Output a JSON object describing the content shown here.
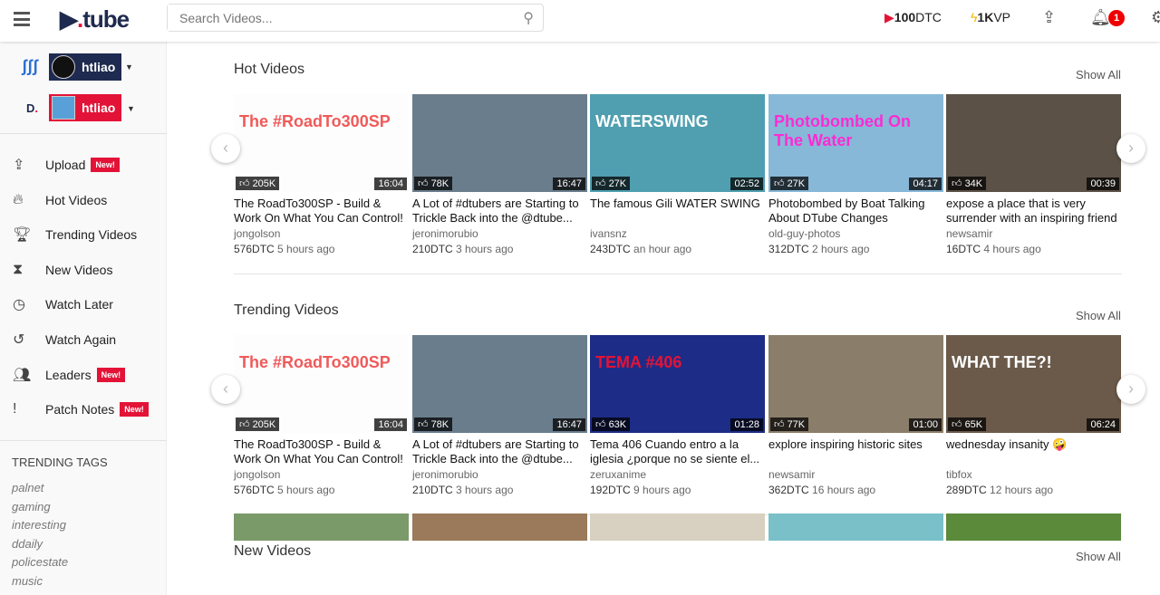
{
  "header": {
    "logo": "D.tube",
    "search_placeholder": "Search Videos...",
    "dtc": "100",
    "dtc_unit": "DTC",
    "vp": "1K",
    "vp_unit": "VP",
    "notif_count": "1"
  },
  "sidebar": {
    "accounts": [
      {
        "network": "steem",
        "name": "htliao"
      },
      {
        "network": "dtube",
        "name": "htliao"
      }
    ],
    "items": [
      {
        "label": "Upload",
        "icon": "upload-icon",
        "new": "New!"
      },
      {
        "label": "Hot Videos",
        "icon": "fire-icon"
      },
      {
        "label": "Trending Videos",
        "icon": "trophy-icon"
      },
      {
        "label": "New Videos",
        "icon": "hourglass-icon"
      },
      {
        "label": "Watch Later",
        "icon": "clock-icon"
      },
      {
        "label": "Watch Again",
        "icon": "history-icon"
      },
      {
        "label": "Leaders",
        "icon": "users-icon",
        "new": "New!"
      },
      {
        "label": "Patch Notes",
        "icon": "exclamation-icon",
        "new": "New!"
      }
    ],
    "trending_title": "TRENDING TAGS",
    "tags": [
      "palnet",
      "gaming",
      "interesting",
      "ddaily",
      "policestate",
      "music"
    ]
  },
  "sections": [
    {
      "title": "Hot Videos",
      "show_all": "Show All",
      "videos": [
        {
          "title": "The RoadTo300SP - Build & Work On What You Can Control!",
          "author": "jongolson",
          "value": "576DTC",
          "time": "5 hours ago",
          "views": "205K",
          "duration": "16:04",
          "thumb_text": "The #RoadTo300SP",
          "color": "#fdfdfd",
          "tcolor": "#f05a5a"
        },
        {
          "title": "A Lot of #dtubers are Starting to Trickle Back into the @dtube...",
          "author": "jeronimorubio",
          "value": "210DTC",
          "time": "3 hours ago",
          "views": "78K",
          "duration": "16:47",
          "thumb_text": "",
          "color": "#6a7d8c"
        },
        {
          "title": "The famous Gili WATER SWING",
          "author": "ivansnz",
          "value": "243DTC",
          "time": "an hour ago",
          "views": "27K",
          "duration": "02:52",
          "thumb_text": "WATERSWING",
          "color": "#4f9fb0",
          "tcolor": "#fff"
        },
        {
          "title": "Photobombed by Boat Talking About DTube Changes",
          "author": "old-guy-photos",
          "value": "312DTC",
          "time": "2 hours ago",
          "views": "27K",
          "duration": "04:17",
          "thumb_text": "Photobombed On The Water",
          "color": "#87b8d8",
          "tcolor": "#ff2ad4"
        },
        {
          "title": "expose a place that is very surrender with an inspiring friend",
          "author": "newsamir",
          "value": "16DTC",
          "time": "4 hours ago",
          "views": "34K",
          "duration": "00:39",
          "thumb_text": "",
          "color": "#5b5146"
        }
      ]
    },
    {
      "title": "Trending Videos",
      "show_all": "Show All",
      "videos": [
        {
          "title": "The RoadTo300SP - Build & Work On What You Can Control!",
          "author": "jongolson",
          "value": "576DTC",
          "time": "5 hours ago",
          "views": "205K",
          "duration": "16:04",
          "thumb_text": "The #RoadTo300SP",
          "color": "#fdfdfd",
          "tcolor": "#f05a5a"
        },
        {
          "title": "A Lot of #dtubers are Starting to Trickle Back into the @dtube...",
          "author": "jeronimorubio",
          "value": "210DTC",
          "time": "3 hours ago",
          "views": "78K",
          "duration": "16:47",
          "thumb_text": "",
          "color": "#6a7d8c"
        },
        {
          "title": "Tema 406 Cuando entro a la iglesia ¿porque no se siente el...",
          "author": "zeruxanime",
          "value": "192DTC",
          "time": "9 hours ago",
          "views": "63K",
          "duration": "01:28",
          "thumb_text": "TEMA #406",
          "color": "#1d2c86",
          "tcolor": "#e31337"
        },
        {
          "title": "explore inspiring historic sites",
          "author": "newsamir",
          "value": "362DTC",
          "time": "16 hours ago",
          "views": "77K",
          "duration": "01:00",
          "thumb_text": "",
          "color": "#8a7d6a"
        },
        {
          "title": "wednesday insanity 🤪",
          "author": "tibfox",
          "value": "289DTC",
          "time": "12 hours ago",
          "views": "65K",
          "duration": "06:24",
          "thumb_text": "WHAT THE?!",
          "color": "#6b5a4a",
          "tcolor": "#fff"
        }
      ]
    },
    {
      "title": "New Videos",
      "show_all": "Show All",
      "videos": []
    }
  ]
}
